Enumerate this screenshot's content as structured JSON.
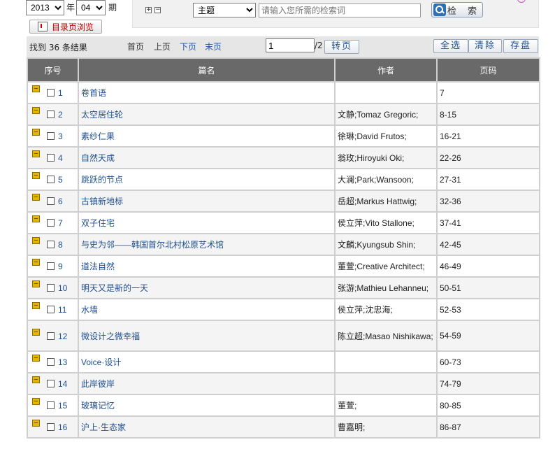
{
  "filters": {
    "year": "2013",
    "year_label": "年",
    "issue": "04",
    "issue_label": "期",
    "catalog_button": "目录页浏览"
  },
  "search": {
    "tree_plus": "+",
    "tree_minus": "−",
    "field_selected": "主题",
    "keyword_placeholder": "请输入您所需的检索词",
    "button_label": "检 索"
  },
  "toolbar": {
    "result_summary": "找到 36 条结果",
    "first_page": "首页",
    "prev_page": "上页",
    "next_page": "下页",
    "last_page": "末页",
    "page_value": "1",
    "page_total": "/2",
    "goto_label": "转页",
    "select_all": "全选",
    "clear": "清除",
    "save": "存盘"
  },
  "table": {
    "headers": [
      "序号",
      "篇名",
      "作者",
      "页码"
    ],
    "rows": [
      {
        "no": "1",
        "title": "卷首语",
        "author": "",
        "pages": "7"
      },
      {
        "no": "2",
        "title": "太空居住轮",
        "author": "文静;Tomaz Gregoric;",
        "pages": "8-15"
      },
      {
        "no": "3",
        "title": "素纱仁果",
        "author": "徐琳;David Frutos;",
        "pages": "16-21"
      },
      {
        "no": "4",
        "title": "自然天成",
        "author": "翁玫;Hiroyuki Oki;",
        "pages": "22-26"
      },
      {
        "no": "5",
        "title": "跳跃的节点",
        "author": "大澜;Park;Wansoon;",
        "pages": "27-31"
      },
      {
        "no": "6",
        "title": "古镇新地标",
        "author": "岳超;Markus Hattwig;",
        "pages": "32-36"
      },
      {
        "no": "7",
        "title": "双子住宅",
        "author": "侯立萍;Vito Stallone;",
        "pages": "37-41"
      },
      {
        "no": "8",
        "title": "与史为邻——韩国首尔北村松原艺术馆",
        "author": "文麟;Kyungsub Shin;",
        "pages": "42-45"
      },
      {
        "no": "9",
        "title": "道法自然",
        "author": "董萱;Creative Architect;",
        "pages": "46-49"
      },
      {
        "no": "10",
        "title": "明天又是新的一天",
        "author": "张游;Mathieu Lehanneu;",
        "pages": "50-51"
      },
      {
        "no": "11",
        "title": "水墙",
        "author": "侯立萍;沈忠海;",
        "pages": "52-53"
      },
      {
        "no": "12",
        "title": "微设计之微幸福",
        "author": "陈立超;Masao Nishikawa;",
        "pages": "54-59"
      },
      {
        "no": "13",
        "title": "Voice·设计",
        "author": "",
        "pages": "60-73"
      },
      {
        "no": "14",
        "title": "此岸彼岸",
        "author": "",
        "pages": "74-79"
      },
      {
        "no": "15",
        "title": "玻璃记忆",
        "author": "董萱;",
        "pages": "80-85"
      },
      {
        "no": "16",
        "title": "沪上·生态家",
        "author": "曹嘉明;",
        "pages": "86-87"
      }
    ]
  }
}
